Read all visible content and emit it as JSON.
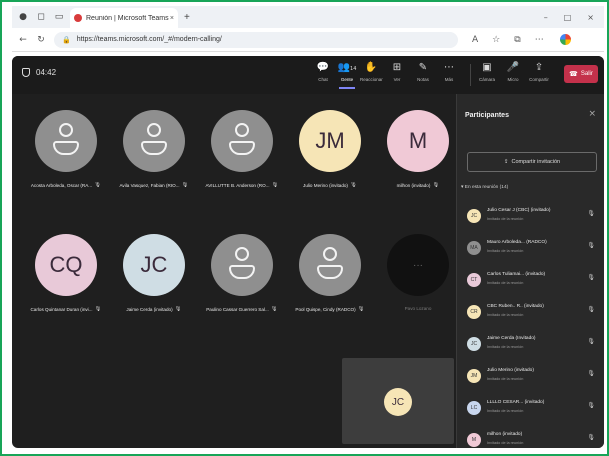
{
  "browser": {
    "tab_title": "Reunión | Microsoft Teams",
    "tab_close": "×",
    "new_tab": "+",
    "url": "https://teams.microsoft.com/_#/modern-calling/",
    "window_controls": [
      "–",
      "□",
      "×"
    ]
  },
  "meeting": {
    "timer": "04:42",
    "toolbar": [
      {
        "icon": "chat-icon",
        "glyph": "💬",
        "label": "Chat"
      },
      {
        "icon": "people-icon",
        "glyph": "👥",
        "label": "Gente",
        "count": "14"
      },
      {
        "icon": "raise-hand-icon",
        "glyph": "✋",
        "label": "Reaccionar"
      },
      {
        "icon": "view-icon",
        "glyph": "⊞",
        "label": "Ver"
      },
      {
        "icon": "notes-icon",
        "glyph": "✎",
        "label": "Notas"
      },
      {
        "icon": "more-icon",
        "glyph": "⋯",
        "label": "Más"
      }
    ],
    "media": [
      {
        "icon": "camera-icon",
        "glyph": "▣",
        "label": "Cámara"
      },
      {
        "icon": "mic-icon",
        "glyph": "🎤",
        "label": "Micro"
      },
      {
        "icon": "share-icon",
        "glyph": "⇪",
        "label": "Compartir"
      }
    ],
    "leave_label": "Salir"
  },
  "gallery": {
    "tiles": [
      {
        "type": "gray",
        "name": "Acosta Arboleda, Oscar (RA..."
      },
      {
        "type": "gray",
        "name": "Avila Vasquez, Fabian (RIO..."
      },
      {
        "type": "gray",
        "name": "AVILLUTTE B. Anderson (RO..."
      },
      {
        "type": "initials",
        "initials": "JM",
        "color": "#f6e5b6",
        "name": "Julio Merino (invitado)"
      },
      {
        "type": "initials",
        "initials": "M",
        "color": "#f0c9d6",
        "name": "milhon (invitado)"
      },
      {
        "type": "initials",
        "initials": "CQ",
        "color": "#e8c9d8",
        "name": "Carlos Quintanar Duran (invi..."
      },
      {
        "type": "initials",
        "initials": "JC",
        "color": "#cfdde4",
        "name": "Jaime Cerda (invitado)"
      },
      {
        "type": "gray",
        "name": "Paulino Cassar Guerrero Sal..."
      },
      {
        "type": "gray",
        "name": "Pool Quispe, Cindy (RADCO)"
      },
      {
        "type": "dark",
        "initials": "···",
        "name": "Pavo Lozano"
      }
    ],
    "self": {
      "initials": "JC",
      "color": "#f6e5b6"
    }
  },
  "participants": {
    "title": "Participantes",
    "close": "×",
    "share_label": "Compartir invitación",
    "section_label": "En esta reunión (14)",
    "list": [
      {
        "initials": "JC",
        "color": "#f6e5b6",
        "name": "Julio Cesar J (CBC) (invitado)",
        "status": "Invitado de la reunión"
      },
      {
        "initials": "MA",
        "color": "#8f8f8f",
        "name": "Mauro Arboleda... (RADCO)",
        "status": "Invitado de la reunión"
      },
      {
        "initials": "CT",
        "color": "#e8c9d8",
        "name": "Carlos Tuliamai... (invitado)",
        "status": "Invitado de la reunión"
      },
      {
        "initials": "CR",
        "color": "#f6e5b6",
        "name": "CBC Ruben.. R.. (invitado)",
        "status": "Invitado de la reunión"
      },
      {
        "initials": "JC",
        "color": "#cfdde4",
        "name": "Jaime Cerda (Invitado)",
        "status": "Invitado de la reunión"
      },
      {
        "initials": "JM",
        "color": "#f6e5b6",
        "name": "Julio Merino (invitado)",
        "status": "Invitado de la reunión"
      },
      {
        "initials": "LC",
        "color": "#c8d6ee",
        "name": "LLLLO CESAR... (invitado)",
        "status": "Invitado de la reunión"
      },
      {
        "initials": "M",
        "color": "#f0c9d6",
        "name": "milhon (invitado)",
        "status": "Invitado de la reunión"
      }
    ]
  }
}
